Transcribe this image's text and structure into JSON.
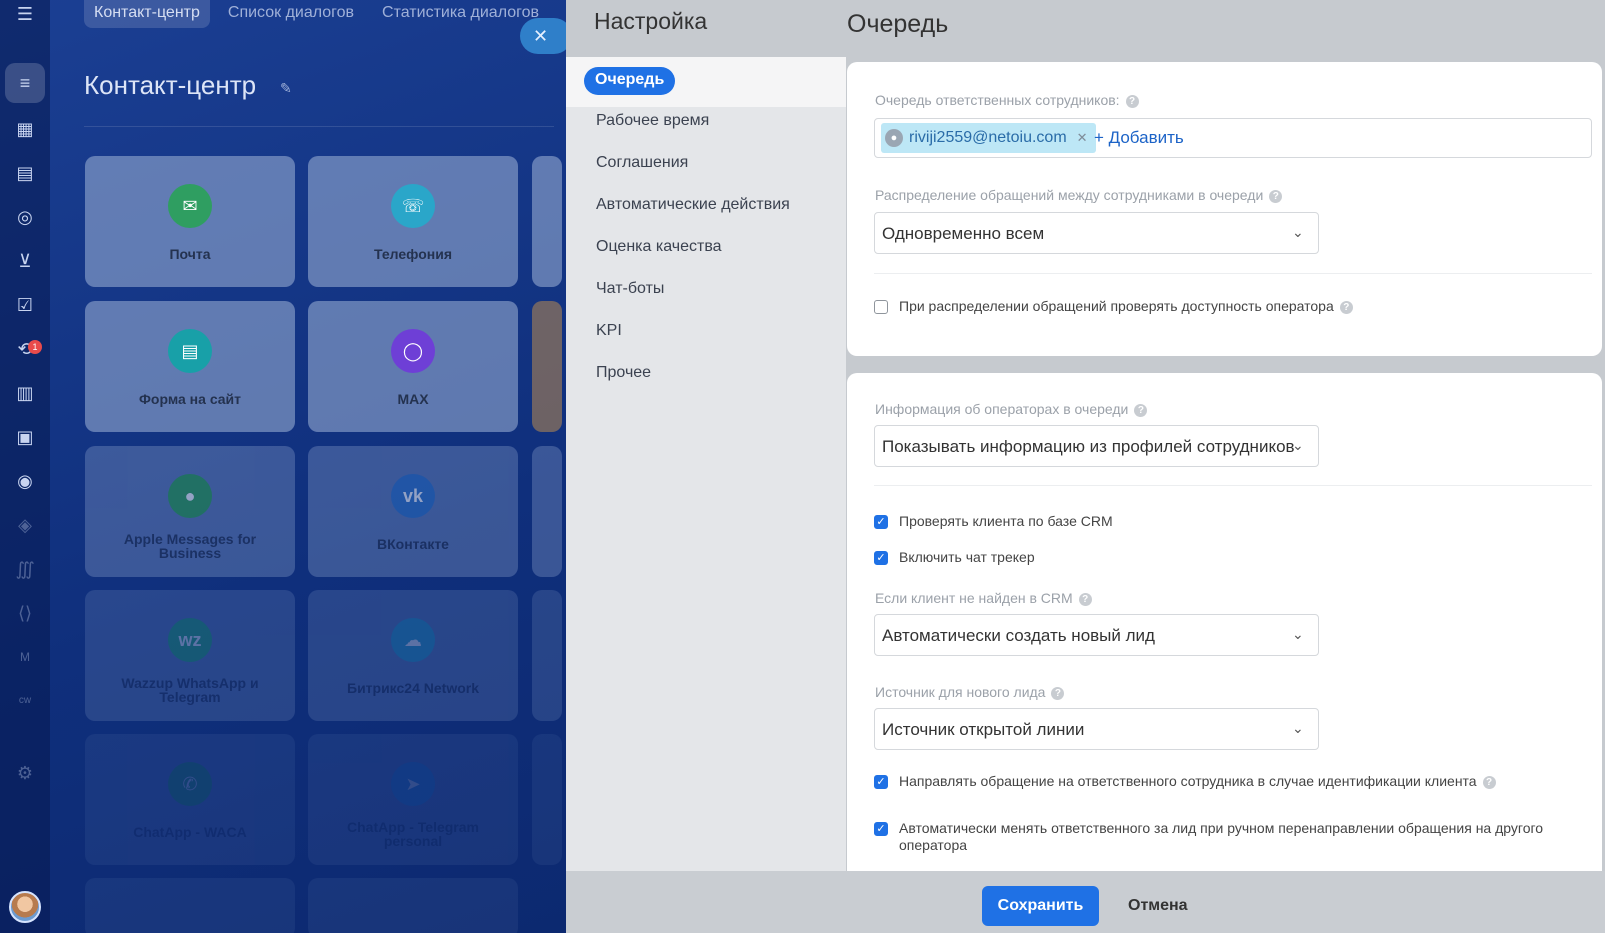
{
  "background": {
    "top_tabs": [
      "Контакт-центр",
      "Список диалогов",
      "Статистика диалогов"
    ],
    "page_title": "Контакт-центр",
    "tiles": [
      {
        "label": "Почта",
        "icon": "mail-icon",
        "color": "#2f9e61"
      },
      {
        "label": "Телефония",
        "icon": "phone-icon",
        "color": "#2aa6c9"
      },
      {
        "label": "Форма на сайт",
        "icon": "form-icon",
        "color": "#18a0a8"
      },
      {
        "label": "MAX",
        "icon": "max-icon",
        "color": "#6e3fd6"
      },
      {
        "label": "Apple Messages for Business",
        "icon": "apple-messages-icon",
        "color": "#2fa34e"
      },
      {
        "label": "ВКонтакте",
        "icon": "vk-icon",
        "color": "#2f74c7"
      },
      {
        "label": "Wazzup WhatsApp и Telegram",
        "icon": "wazzup-icon",
        "color": "#26b26a"
      },
      {
        "label": "Битрикс24 Network",
        "icon": "cloud-icon",
        "color": "#2aa6c9"
      },
      {
        "label": "ChatApp - WACA",
        "icon": "whatsapp-icon",
        "color": "#28b04a"
      },
      {
        "label": "ChatApp - Telegram personal",
        "icon": "telegram-icon",
        "color": "#2a8ed8"
      }
    ],
    "badge_count": "1"
  },
  "panel": {
    "settings_title": "Настройка",
    "page_title": "Очередь",
    "menu": [
      "Очередь",
      "Рабочее время",
      "Соглашения",
      "Автоматические действия",
      "Оценка качества",
      "Чат-боты",
      "KPI",
      "Прочее"
    ],
    "queue": {
      "label": "Очередь ответственных сотрудников:",
      "user": "riviji2559@netoiu.com",
      "add_label": "+ Добавить"
    },
    "distribution": {
      "label": "Распределение обращений между сотрудниками в очереди",
      "value": "Одновременно всем"
    },
    "check_availability": {
      "label": "При распределении обращений проверять доступность оператора",
      "checked": false
    },
    "operator_info": {
      "label": "Информация об операторах в очереди",
      "value": "Показывать информацию из профилей сотрудников"
    },
    "crm_check": {
      "label": "Проверять клиента по базе CRM",
      "checked": true
    },
    "chat_tracker": {
      "label": "Включить чат трекер",
      "checked": true
    },
    "not_found": {
      "label": "Если клиент не найден в CRM",
      "value": "Автоматически создать новый лид"
    },
    "lead_source": {
      "label": "Источник для нового лида",
      "value": "Источник открытой линии"
    },
    "route_responsible": {
      "label": "Направлять обращение на ответственного сотрудника в случае идентификации клиента",
      "checked": true
    },
    "auto_change": {
      "label": "Автоматически менять ответственного за лид при ручном перенаправлении обращения на другого оператора",
      "checked": true
    },
    "save_label": "Сохранить",
    "cancel_label": "Отмена"
  },
  "colors": {
    "accent": "#1f71e5",
    "chip": "#bde7f6"
  }
}
